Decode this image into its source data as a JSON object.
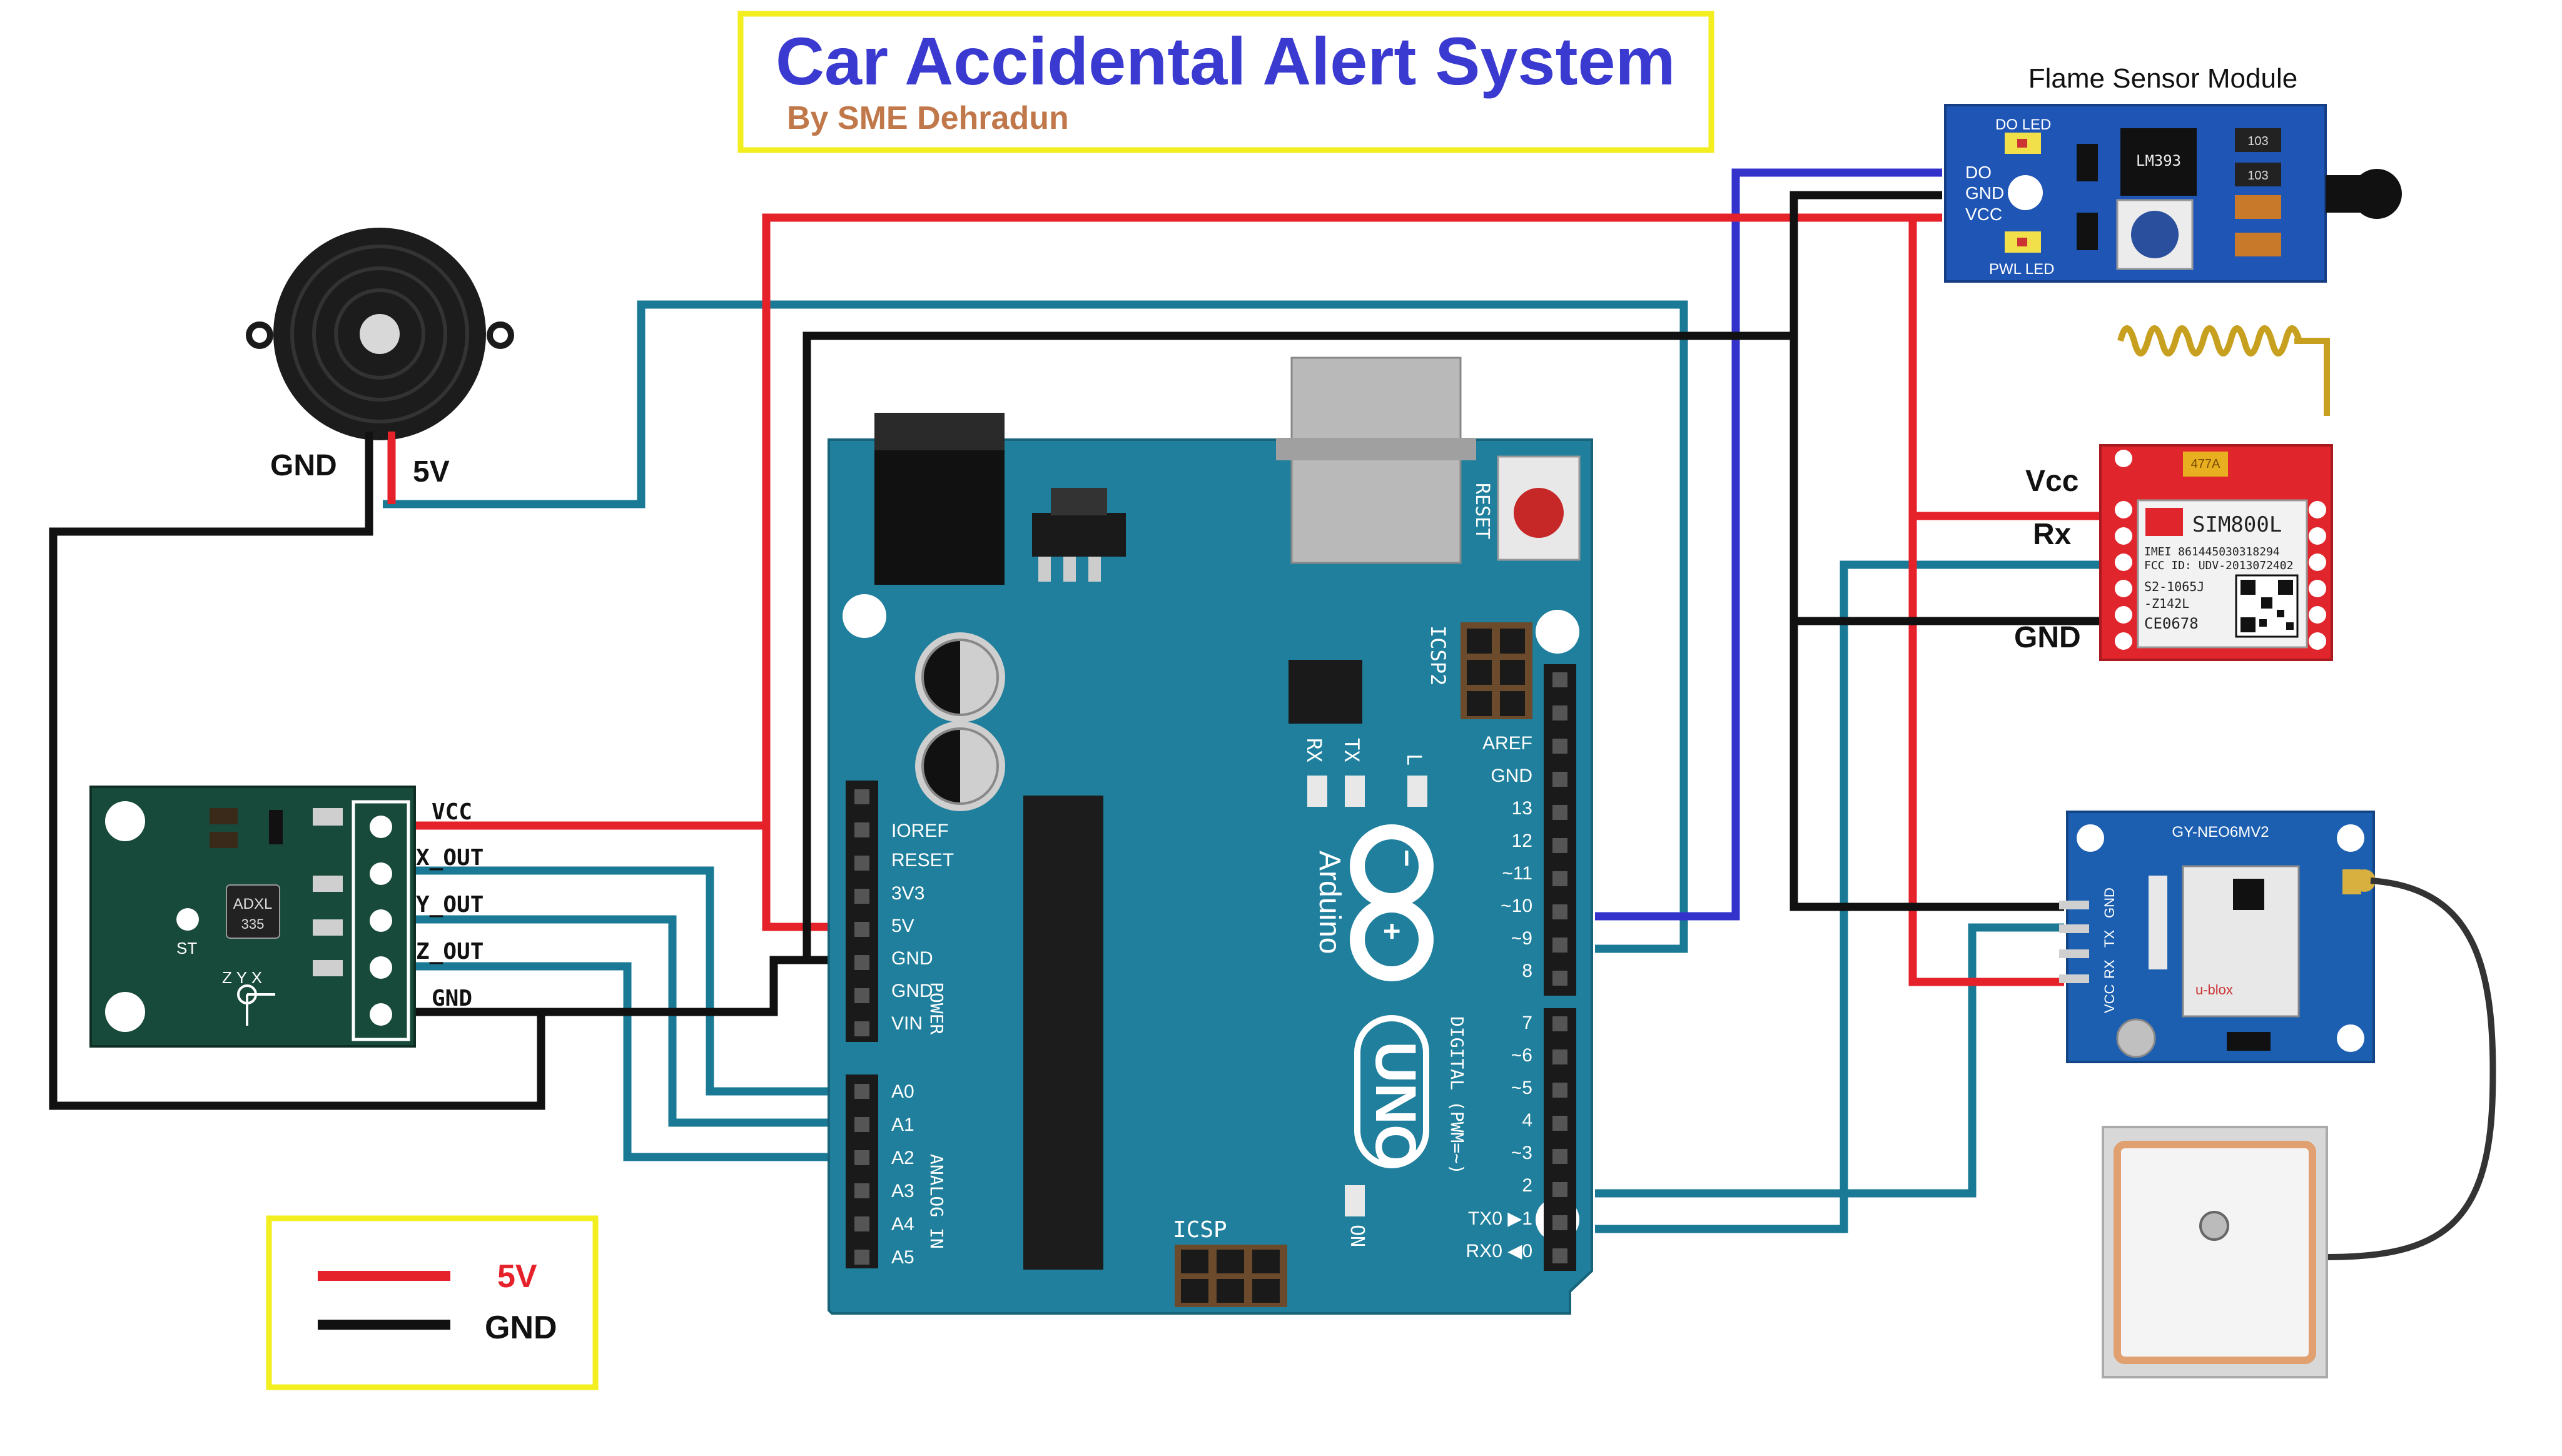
{
  "title": "Car Accidental Alert System",
  "subtitle": "By SME Dehradun",
  "colors": {
    "title": "#3a3ad0",
    "subtitle": "#c0784a",
    "frame": "#f2ee1f",
    "wire_5v": "#e5212a",
    "wire_gnd": "#111111",
    "wire_signal": "#1a7a96",
    "wire_do": "#3333cc",
    "board": "#1f7f9c",
    "adxl_board": "#174a3a",
    "flame_board": "#1f55b4",
    "gps_board": "#1c5fb0",
    "gsm_board": "#e0262c"
  },
  "buzzer": {
    "icon": "buzzer-icon",
    "gnd_label": "GND",
    "vcc_label": "5V"
  },
  "adxl": {
    "chip": "ADXL",
    "chip_num": "335",
    "st": "ST",
    "axes": "Z  Y  X",
    "pins": [
      "VCC",
      "X_OUT",
      "Y_OUT",
      "Z_OUT",
      "GND"
    ]
  },
  "flame": {
    "title": "Flame Sensor Module",
    "pins": [
      "DO",
      "GND",
      "VCC"
    ],
    "do_led": "DO LED",
    "pwl_led": "PWL LED",
    "chip": "LM393",
    "res1": "103",
    "res2": "103"
  },
  "gsm": {
    "vcc_label": "Vcc",
    "rx_label": "Rx",
    "gnd_label": "GND",
    "model": "SIM800L",
    "imei": "IMEI 861445030318294",
    "fcc": "FCC ID: UDV-2013072402",
    "code1": "S2-1065J",
    "code2": "-Z142L",
    "ce": "CE0678",
    "cap": "477A"
  },
  "gps": {
    "title": "GY-NEO6MV2",
    "pins": [
      "VCC",
      "RX",
      "TX",
      "GND"
    ],
    "chip": "u-blox"
  },
  "arduino": {
    "reset": "RESET",
    "icsp2": "ICSP2",
    "icsp": "ICSP",
    "rx": "RX",
    "tx": "TX",
    "l": "L",
    "on": "ON",
    "brand": "Arduino",
    "model": "UNO",
    "power_label": "POWER",
    "analog_label": "ANALOG IN",
    "digital_label": "DIGITAL (PWM=~)",
    "power_pins": [
      "IOREF",
      "RESET",
      "3V3",
      "5V",
      "GND",
      "GND",
      "VIN"
    ],
    "analog_pins": [
      "A0",
      "A1",
      "A2",
      "A3",
      "A4",
      "A5"
    ],
    "digital_top": [
      "AREF",
      "GND",
      "13",
      "12",
      "~11",
      "~10",
      "~9",
      "8"
    ],
    "digital_bottom": [
      "7",
      "~6",
      "~5",
      "4",
      "~3",
      "2",
      "TX0 ▶1",
      "RX0 ◀0"
    ]
  },
  "legend": {
    "items": [
      {
        "label": "5V",
        "color": "#e5212a"
      },
      {
        "label": "GND",
        "color": "#111111"
      }
    ]
  }
}
